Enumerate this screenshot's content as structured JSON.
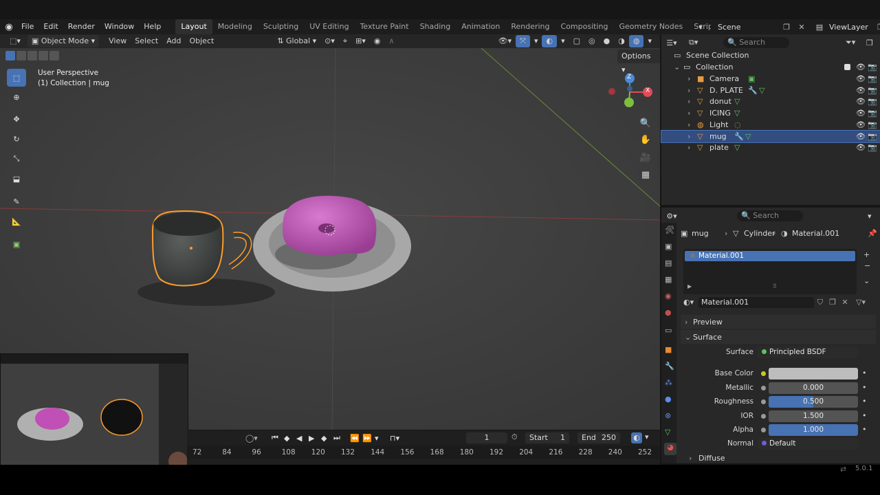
{
  "menu": [
    "File",
    "Edit",
    "Render",
    "Window",
    "Help"
  ],
  "workspaces": [
    "Layout",
    "Modeling",
    "Sculpting",
    "UV Editing",
    "Texture Paint",
    "Shading",
    "Animation",
    "Rendering",
    "Compositing",
    "Geometry Nodes",
    "Scripting"
  ],
  "active_workspace": "Layout",
  "scene": {
    "name": "Scene",
    "view_layer": "ViewLayer"
  },
  "viewport_header": {
    "mode": "Object Mode",
    "menus": [
      "View",
      "Select",
      "Add",
      "Object"
    ],
    "orientation": "Global",
    "options": "Options"
  },
  "viewport": {
    "perspective": "User Perspective",
    "context": "(1) Collection | mug",
    "gizmo": {
      "z": "Z",
      "x": "X",
      "y": "Y"
    }
  },
  "outliner": {
    "search_placeholder": "Search",
    "root": "Scene Collection",
    "collection": "Collection",
    "items": [
      {
        "name": "Camera",
        "type": "camera",
        "selected": false
      },
      {
        "name": "D. PLATE",
        "type": "mesh",
        "selected": false
      },
      {
        "name": "donut",
        "type": "mesh",
        "selected": false
      },
      {
        "name": "ICING",
        "type": "mesh",
        "selected": false
      },
      {
        "name": "Light",
        "type": "light",
        "selected": false
      },
      {
        "name": "mug",
        "type": "mesh",
        "selected": true
      },
      {
        "name": "plate",
        "type": "mesh",
        "selected": false
      }
    ]
  },
  "properties": {
    "search_placeholder": "Search",
    "breadcrumb": [
      "mug",
      "Cylinder",
      "Material.001"
    ],
    "slot": "Material.001",
    "material_name": "Material.001",
    "panels": {
      "preview": "Preview",
      "surface": "Surface",
      "diffuse": "Diffuse"
    },
    "surface_label": "Surface",
    "surface_shader": "Principled BSDF",
    "fields": [
      {
        "label": "Base Color",
        "value": "",
        "type": "color"
      },
      {
        "label": "Metallic",
        "value": "0.000",
        "fill": 0.0
      },
      {
        "label": "Roughness",
        "value": "0.500",
        "fill": 0.5
      },
      {
        "label": "IOR",
        "value": "1.500",
        "fill": 0.0
      },
      {
        "label": "Alpha",
        "value": "1.000",
        "fill": 1.0
      }
    ],
    "normal_label": "Normal",
    "normal_value": "Default"
  },
  "timeline": {
    "current_frame": "1",
    "start_label": "Start",
    "start": "1",
    "end_label": "End",
    "end": "250",
    "ticks": [
      "72",
      "84",
      "96",
      "108",
      "120",
      "132",
      "144",
      "156",
      "168",
      "180",
      "192",
      "204",
      "216",
      "228",
      "240",
      "252"
    ]
  },
  "version": "5.0.1",
  "colors": {
    "accent": "#4772b3",
    "selection": "#ff9c2b",
    "icing": "#c44fb6"
  }
}
